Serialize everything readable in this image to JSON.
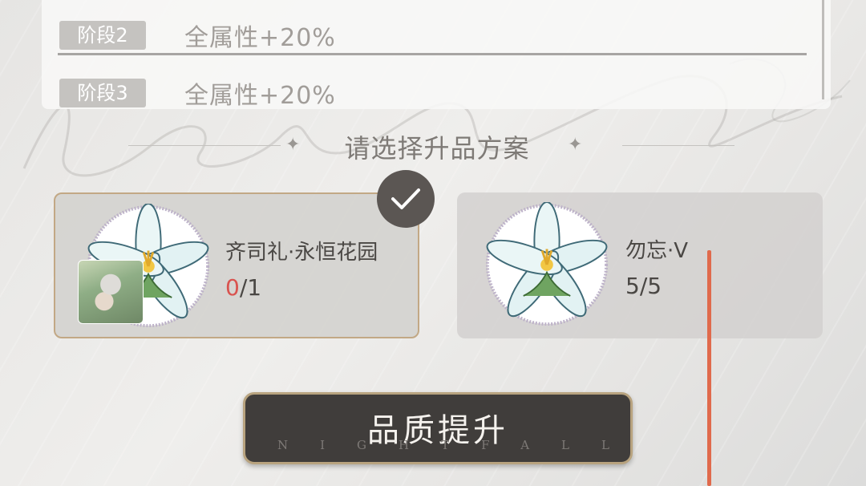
{
  "stages": [
    {
      "badge": "阶段2",
      "effect": "全属性+20%"
    },
    {
      "badge": "阶段3",
      "effect": "全属性+20%"
    }
  ],
  "section_title": "请选择升品方案",
  "options": [
    {
      "name": "齐司礼·永恒花园",
      "count_current": "0",
      "count_sep_total": "/1",
      "selected": true,
      "current_color": "#d9534f"
    },
    {
      "name": "勿忘·V",
      "count": "5/5",
      "selected": false
    }
  ],
  "upgrade_button": {
    "label": "品质提升",
    "subtitle": "NIGHTFALL"
  },
  "colors": {
    "accent_gold": "#c2a885",
    "button_bg": "#403d3b",
    "marker_red": "#e06a4c"
  },
  "icons": [
    "sparkle-icon",
    "lily-flower-icon",
    "check-icon",
    "character-avatar"
  ]
}
